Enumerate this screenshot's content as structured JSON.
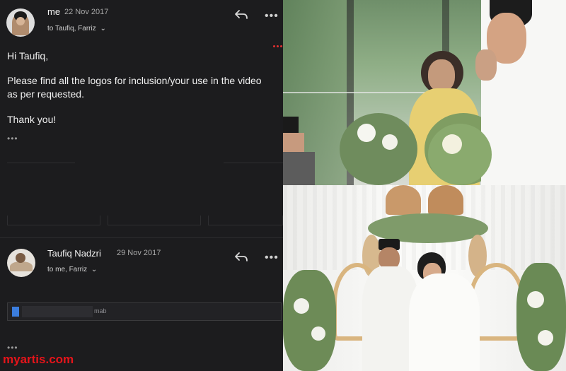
{
  "email_thread": {
    "message1": {
      "sender": "me",
      "date": "22 Nov 2017",
      "recipients": "to Taufiq, Farriz",
      "chevron": "⌄",
      "greeting": "Hi Taufiq,",
      "body": "Please find all the logos for inclusion/your use in the video as per requested.",
      "signoff": "Thank you!",
      "ellipsis": "•••",
      "icons": {
        "reply": "reply-icon",
        "more": "more-icon",
        "chevron": "chevron-down-icon"
      }
    },
    "message2": {
      "sender": "Taufiq Nadzri",
      "date": "29 Nov 2017",
      "recipients": "to me, Farriz",
      "chevron": "⌄",
      "attachment_name": "mab",
      "ellipsis": "•••",
      "icons": {
        "reply": "reply-icon",
        "more": "more-icon",
        "chevron": "chevron-down-icon",
        "file": "file-icon"
      }
    },
    "more_glyph": "•••"
  },
  "watermark": "myartis.com",
  "colors": {
    "panel_bg": "#1c1c1e",
    "watermark": "#e5141a",
    "notification_dots": "#e03030",
    "attachment_icon": "#3b7ddd"
  },
  "photos": {
    "top": "wedding-photo-bride-emotional",
    "bottom": "wedding-photo-couple-seated"
  }
}
